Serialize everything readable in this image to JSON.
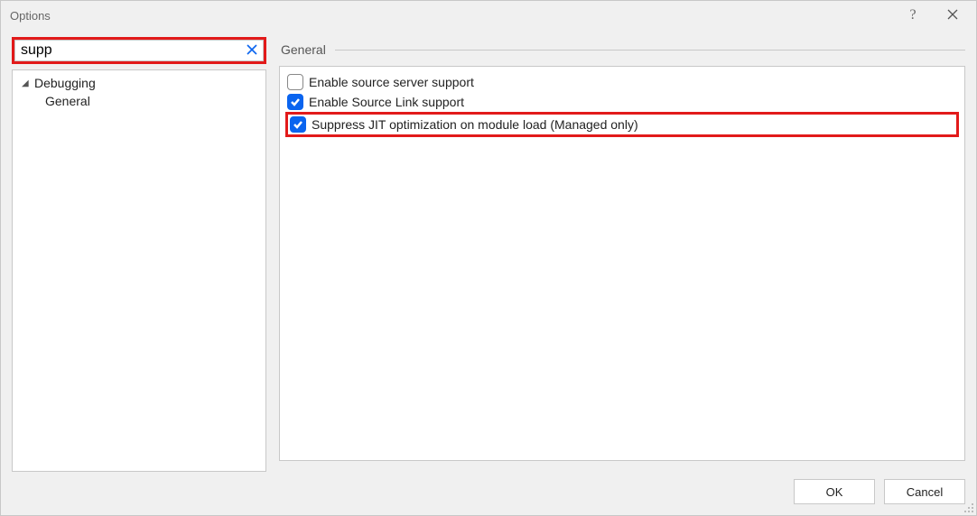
{
  "dialog": {
    "title": "Options"
  },
  "search": {
    "value": "supp"
  },
  "tree": {
    "root": {
      "label": "Debugging"
    },
    "child": {
      "label": "General"
    }
  },
  "content": {
    "header": "General",
    "options": [
      {
        "label": "Enable source server support",
        "checked": false,
        "highlighted": false
      },
      {
        "label": "Enable Source Link support",
        "checked": true,
        "highlighted": false
      },
      {
        "label": "Suppress JIT optimization on module load (Managed only)",
        "checked": true,
        "highlighted": true
      }
    ]
  },
  "buttons": {
    "ok": "OK",
    "cancel": "Cancel"
  }
}
